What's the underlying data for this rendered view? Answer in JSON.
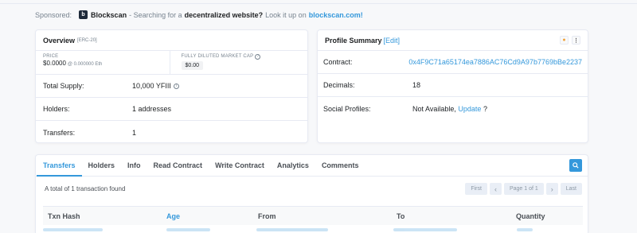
{
  "sponsored": {
    "label": "Sponsored:",
    "brand": "Blockscan",
    "logo_letter": "b",
    "text_pre": "- Searching for a",
    "text_bold": "decentralized website?",
    "text_mid": "Look it up on",
    "link": "blockscan.com!"
  },
  "overview": {
    "title": "Overview",
    "subtitle": "[ERC-20]",
    "price_label": "PRICE",
    "price_value": "$0.0000",
    "price_eth": "@ 0.000000 Eth",
    "mcap_label": "FULLY DILUTED MARKET CAP",
    "mcap_value": "$0.00",
    "rows": [
      {
        "key": "Total Supply:",
        "value": "10,000 YFIII"
      },
      {
        "key": "Holders:",
        "value": "1 addresses"
      },
      {
        "key": "Transfers:",
        "value": "1"
      }
    ]
  },
  "profile": {
    "title": "Profile Summary",
    "edit": "[Edit]",
    "contract_label": "Contract:",
    "contract_value": "0x4F9C71a65174ea7886AC76Cd9A97b7769bBe2237",
    "decimals_label": "Decimals:",
    "decimals_value": "18",
    "social_label": "Social Profiles:",
    "social_value": "Not Available,",
    "social_update": "Update",
    "social_q": "?"
  },
  "tabs": [
    "Transfers",
    "Holders",
    "Info",
    "Read Contract",
    "Write Contract",
    "Analytics",
    "Comments"
  ],
  "transactions": {
    "found_text": "A total of 1 transaction found",
    "pager": {
      "first": "First",
      "prev": "‹",
      "page": "Page 1 of 1",
      "next": "›",
      "last": "Last"
    },
    "columns": [
      "Txn Hash",
      "Age",
      "From",
      "To",
      "Quantity"
    ]
  },
  "colors": {
    "accent": "#3498db",
    "border": "#e7eaf3"
  }
}
